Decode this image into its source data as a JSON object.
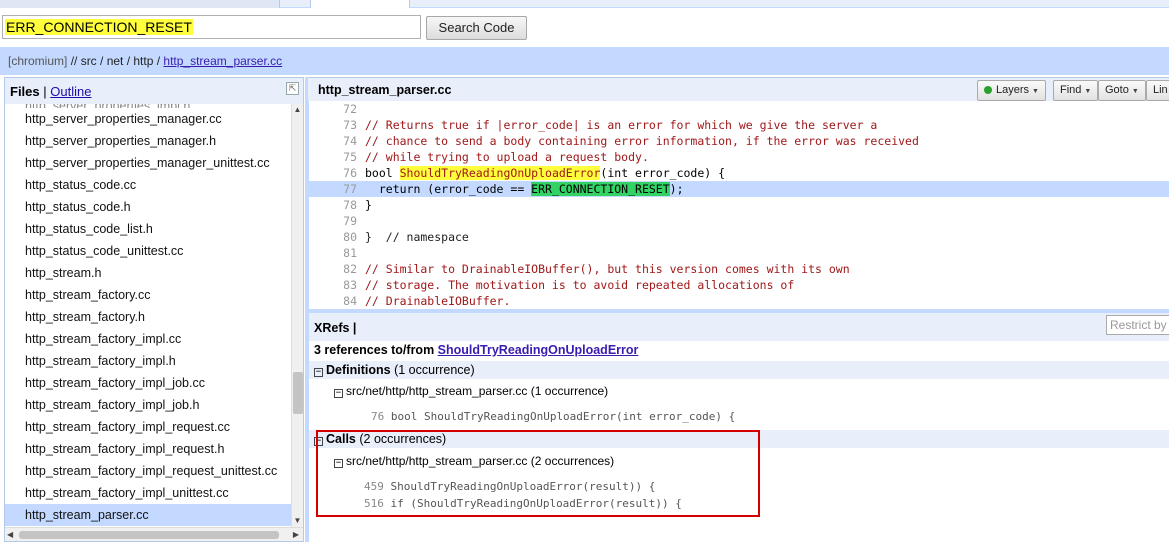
{
  "search": {
    "query": "ERR_CONNECTION_RESET",
    "button_label": "Search Code"
  },
  "breadcrumb": {
    "repo": "[chromium]",
    "path": "// src / net / http /",
    "file_link": "http_stream_parser.cc"
  },
  "left_panel": {
    "files_label": "Files",
    "separator": "|",
    "outline_label": "Outline",
    "files": [
      "http_server_properties_impl.h",
      "http_server_properties_manager.cc",
      "http_server_properties_manager.h",
      "http_server_properties_manager_unittest.cc",
      "http_status_code.cc",
      "http_status_code.h",
      "http_status_code_list.h",
      "http_status_code_unittest.cc",
      "http_stream.h",
      "http_stream_factory.cc",
      "http_stream_factory.h",
      "http_stream_factory_impl.cc",
      "http_stream_factory_impl.h",
      "http_stream_factory_impl_job.cc",
      "http_stream_factory_impl_job.h",
      "http_stream_factory_impl_request.cc",
      "http_stream_factory_impl_request.h",
      "http_stream_factory_impl_request_unittest.cc",
      "http_stream_factory_impl_unittest.cc",
      "http_stream_parser.cc"
    ],
    "selected_file": "http_stream_parser.cc"
  },
  "code_panel": {
    "filename": "http_stream_parser.cc",
    "toolbar": {
      "layers": "Layers",
      "find": "Find",
      "goto": "Goto",
      "lines": "Lin"
    },
    "lines": [
      {
        "n": "72",
        "text": ""
      },
      {
        "n": "73",
        "text": "// Returns true if |error_code| is an error for which we give the server a"
      },
      {
        "n": "74",
        "text": "// chance to send a body containing error information, if the error was received"
      },
      {
        "n": "75",
        "text": "// while trying to upload a request body."
      },
      {
        "n": "76",
        "pre": "bool ",
        "fn": "ShouldTryReadingOnUploadError",
        "post": "(int error_code) {"
      },
      {
        "n": "77",
        "pre": "  return (error_code == ",
        "err": "ERR_CONNECTION_RESET",
        "post": ");"
      },
      {
        "n": "78",
        "text": "}"
      },
      {
        "n": "79",
        "text": ""
      },
      {
        "n": "80",
        "text": "}  // namespace"
      },
      {
        "n": "81",
        "text": ""
      },
      {
        "n": "82",
        "text": "// Similar to DrainableIOBuffer(), but this version comes with its own"
      },
      {
        "n": "83",
        "text": "// storage. The motivation is to avoid repeated allocations of"
      },
      {
        "n": "84",
        "text": "// DrainableIOBuffer."
      }
    ]
  },
  "xrefs": {
    "title": "XRefs |",
    "restrict_placeholder": "Restrict by",
    "summary_prefix": "3 references to/from",
    "summary_link": "ShouldTryReadingOnUploadError",
    "definitions": {
      "label": "Definitions",
      "count": "(1 occurrence)",
      "file": "src/net/http/http_stream_parser.cc",
      "file_count": "(1 occurrence)",
      "lines": [
        {
          "n": "76",
          "code": "bool ShouldTryReadingOnUploadError(int error_code) {"
        }
      ]
    },
    "calls": {
      "label": "Calls",
      "count": "(2 occurrences)",
      "file": "src/net/http/http_stream_parser.cc",
      "file_count": "(2 occurrences)",
      "lines": [
        {
          "n": "459",
          "code": "ShouldTryReadingOnUploadError(result)) {"
        },
        {
          "n": "516",
          "code": "if (ShouldTryReadingOnUploadError(result)) {"
        }
      ]
    }
  }
}
